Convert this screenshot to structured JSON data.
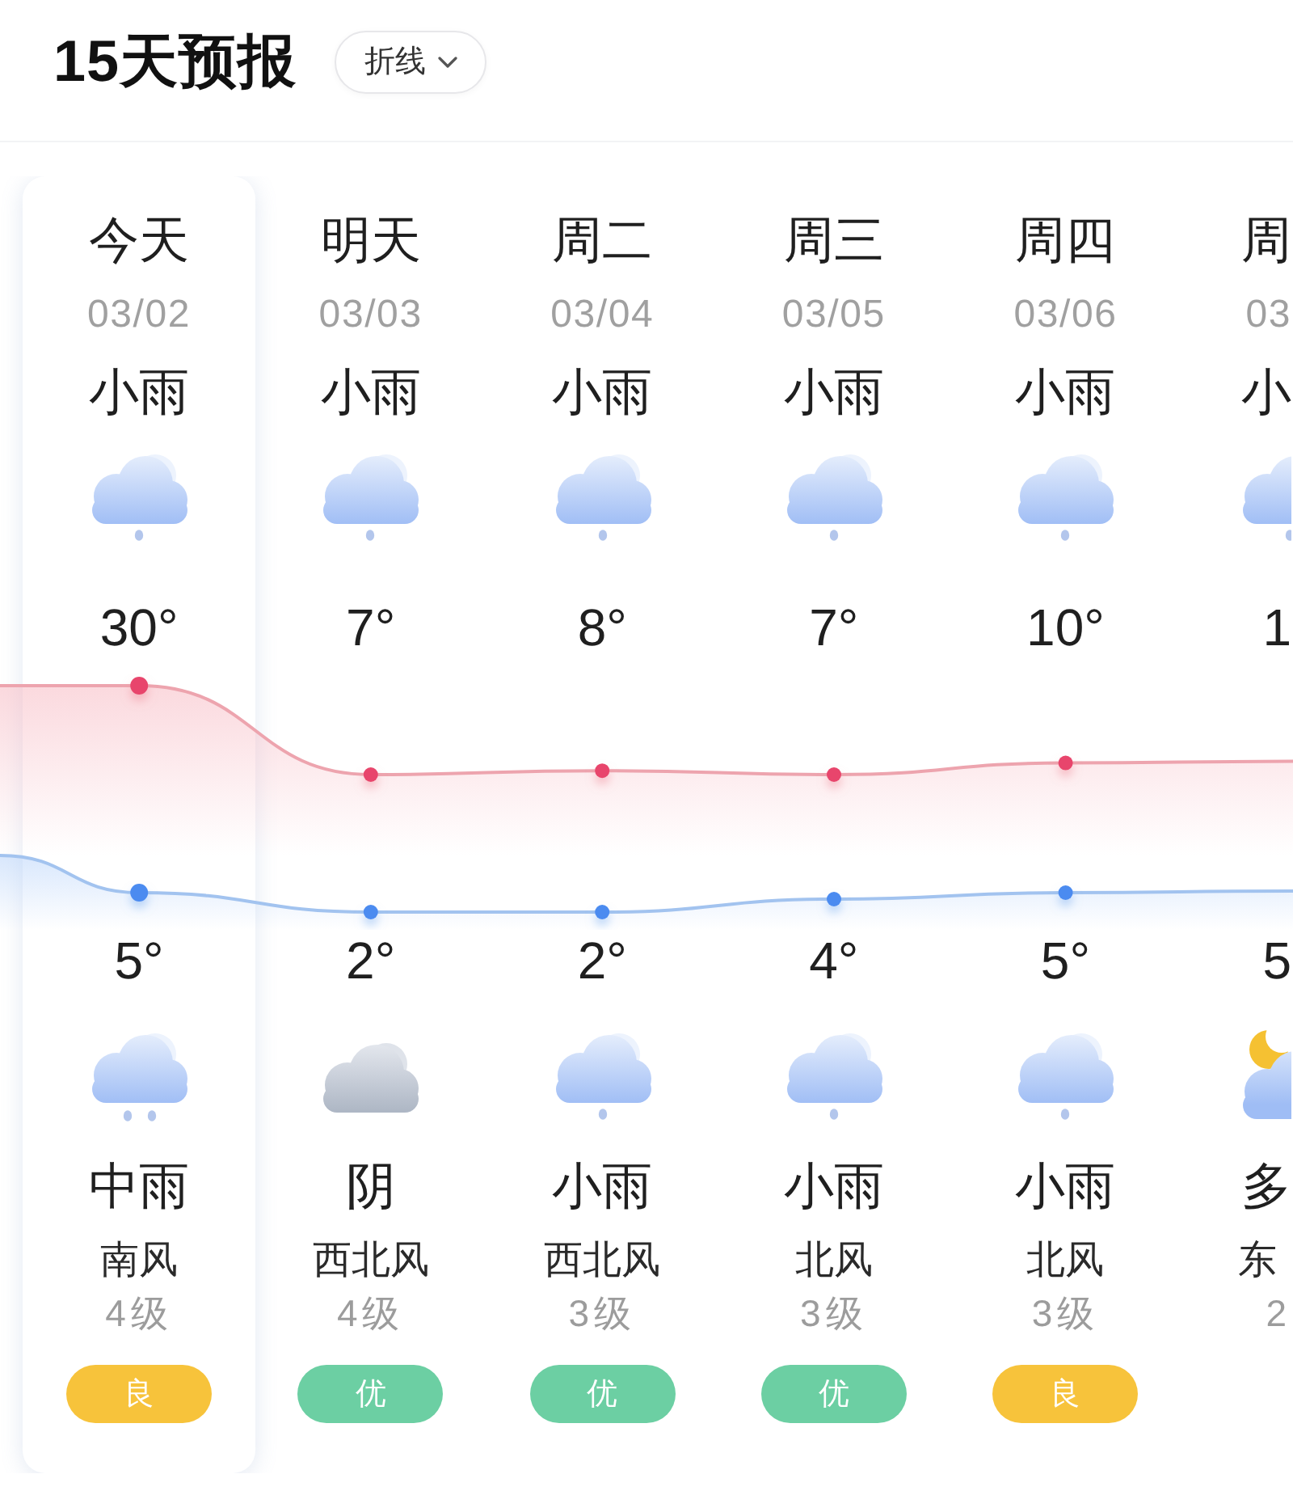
{
  "header": {
    "title": "15天预报",
    "view_dropdown": {
      "label": "折线"
    }
  },
  "days": [
    {
      "day": "今天",
      "date": "03/02",
      "selected": true,
      "day_weather": {
        "text": "小雨",
        "kind": "drizzle"
      },
      "high": "30°",
      "low": "5°",
      "night_weather": {
        "text": "中雨",
        "kind": "rain"
      },
      "wind": "南风",
      "wind_level": "4级",
      "aqi": {
        "text": "良",
        "color": "#f7c33b"
      }
    },
    {
      "day": "明天",
      "date": "03/03",
      "selected": false,
      "day_weather": {
        "text": "小雨",
        "kind": "drizzle"
      },
      "high": "7°",
      "low": "2°",
      "night_weather": {
        "text": "阴",
        "kind": "overcast"
      },
      "wind": "西北风",
      "wind_level": "4级",
      "aqi": {
        "text": "优",
        "color": "#6ccfa3"
      }
    },
    {
      "day": "周二",
      "date": "03/04",
      "selected": false,
      "day_weather": {
        "text": "小雨",
        "kind": "drizzle"
      },
      "high": "8°",
      "low": "2°",
      "night_weather": {
        "text": "小雨",
        "kind": "drizzle"
      },
      "wind": "西北风",
      "wind_level": "3级",
      "aqi": {
        "text": "优",
        "color": "#6ccfa3"
      }
    },
    {
      "day": "周三",
      "date": "03/05",
      "selected": false,
      "day_weather": {
        "text": "小雨",
        "kind": "drizzle"
      },
      "high": "7°",
      "low": "4°",
      "night_weather": {
        "text": "小雨",
        "kind": "drizzle"
      },
      "wind": "北风",
      "wind_level": "3级",
      "aqi": {
        "text": "优",
        "color": "#6ccfa3"
      }
    },
    {
      "day": "周四",
      "date": "03/06",
      "selected": false,
      "day_weather": {
        "text": "小雨",
        "kind": "drizzle"
      },
      "high": "10°",
      "low": "5°",
      "night_weather": {
        "text": "小雨",
        "kind": "drizzle"
      },
      "wind": "北风",
      "wind_level": "3级",
      "aqi": {
        "text": "良",
        "color": "#f7c33b"
      }
    },
    {
      "day": "周",
      "date": "03",
      "selected": false,
      "day_weather": {
        "text": "小",
        "kind": "drizzle"
      },
      "high": "1",
      "low": "5",
      "night_weather": {
        "text": "多",
        "kind": "partlycloudy"
      },
      "wind": "东",
      "wind_level": "2"
    }
  ]
}
